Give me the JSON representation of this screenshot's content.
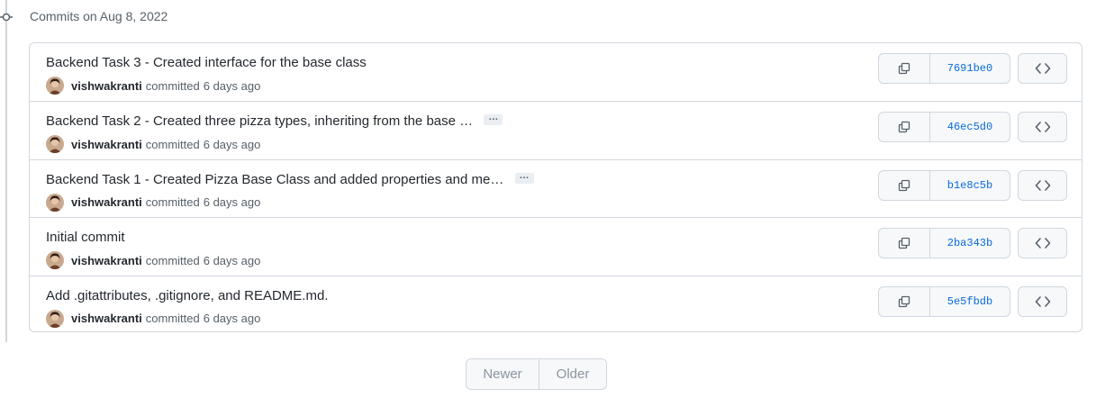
{
  "group": {
    "title": "Commits on Aug 8, 2022"
  },
  "commits": [
    {
      "title": "Backend Task 3 - Created interface for the base class",
      "has_more": false,
      "author": "vishwakranti",
      "committed": "committed",
      "age": "6 days ago",
      "sha": "7691be0"
    },
    {
      "title": "Backend Task 2 - Created three pizza types, inheriting from the base …",
      "has_more": true,
      "more_label": "…",
      "author": "vishwakranti",
      "committed": "committed",
      "age": "6 days ago",
      "sha": "46ec5d0"
    },
    {
      "title": "Backend Task 1 - Created Pizza Base Class and added properties and me…",
      "has_more": true,
      "more_label": "…",
      "author": "vishwakranti",
      "committed": "committed",
      "age": "6 days ago",
      "sha": "b1e8c5b"
    },
    {
      "title": "Initial commit",
      "has_more": false,
      "author": "vishwakranti",
      "committed": "committed",
      "age": "6 days ago",
      "sha": "2ba343b"
    },
    {
      "title": "Add .gitattributes, .gitignore, and README.md.",
      "has_more": false,
      "author": "vishwakranti",
      "committed": "committed",
      "age": "6 days ago",
      "sha": "5e5fbdb"
    }
  ],
  "pagination": {
    "newer": "Newer",
    "older": "Older"
  },
  "icons": {
    "timeline": "git-commit-icon",
    "copy": "copy-icon",
    "browse": "code-icon"
  },
  "colors": {
    "sha_link": "#0969da",
    "border": "#d0d7de",
    "muted": "#57606a",
    "disabled": "#8c959f"
  }
}
